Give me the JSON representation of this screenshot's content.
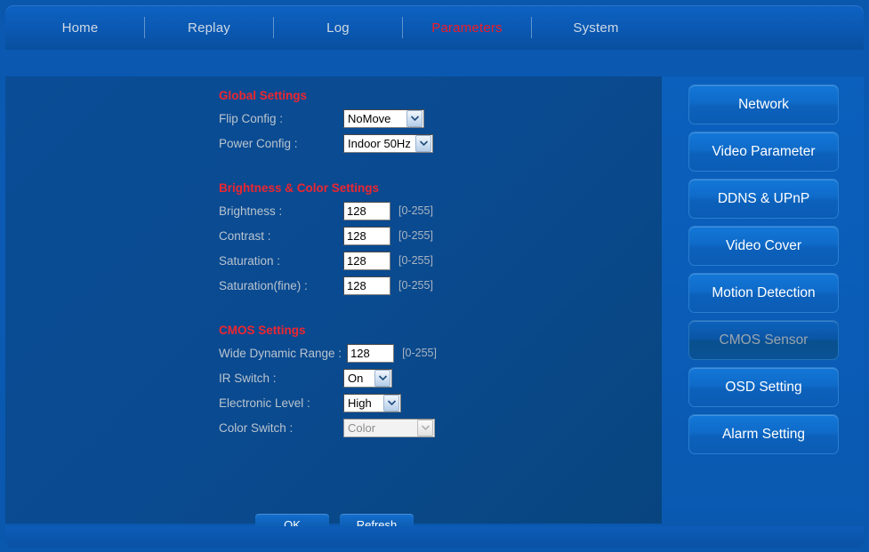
{
  "nav": {
    "items": [
      {
        "label": "Home",
        "active": false
      },
      {
        "label": "Replay",
        "active": false
      },
      {
        "label": "Log",
        "active": false
      },
      {
        "label": "Parameters",
        "active": true
      },
      {
        "label": "System",
        "active": false
      }
    ],
    "active_color": "#ee2630",
    "inactive_color": "#cfd9e4"
  },
  "form": {
    "global": {
      "title": "Global Settings",
      "flip": {
        "label": "Flip Config :",
        "value": "NoMove"
      },
      "power": {
        "label": "Power Config :",
        "value": "Indoor 50Hz"
      }
    },
    "brightness": {
      "title": "Brightness & Color Settings",
      "rows": [
        {
          "label": "Brightness :",
          "value": "128",
          "hint": "[0-255]"
        },
        {
          "label": "Contrast :",
          "value": "128",
          "hint": "[0-255]"
        },
        {
          "label": "Saturation :",
          "value": "128",
          "hint": "[0-255]"
        },
        {
          "label": "Saturation(fine) :",
          "value": "128",
          "hint": "[0-255]"
        }
      ]
    },
    "cmos": {
      "title": "CMOS Settings",
      "wdr": {
        "label": "Wide Dynamic Range :",
        "value": "128",
        "hint": "[0-255]"
      },
      "ir": {
        "label": "IR Switch :",
        "value": "On"
      },
      "electronic": {
        "label": "Electronic Level :",
        "value": "High"
      },
      "color_switch": {
        "label": "Color Switch :",
        "value": "Color",
        "disabled": true
      }
    },
    "actions": {
      "ok": "OK",
      "refresh": "Refresh"
    }
  },
  "sidebar": {
    "items": [
      {
        "label": "Network",
        "active": false
      },
      {
        "label": "Video Parameter",
        "active": false
      },
      {
        "label": "DDNS & UPnP",
        "active": false
      },
      {
        "label": "Video Cover",
        "active": false
      },
      {
        "label": "Motion Detection",
        "active": false
      },
      {
        "label": "CMOS Sensor",
        "active": true
      },
      {
        "label": "OSD Setting",
        "active": false
      },
      {
        "label": "Alarm Setting",
        "active": false
      }
    ]
  }
}
